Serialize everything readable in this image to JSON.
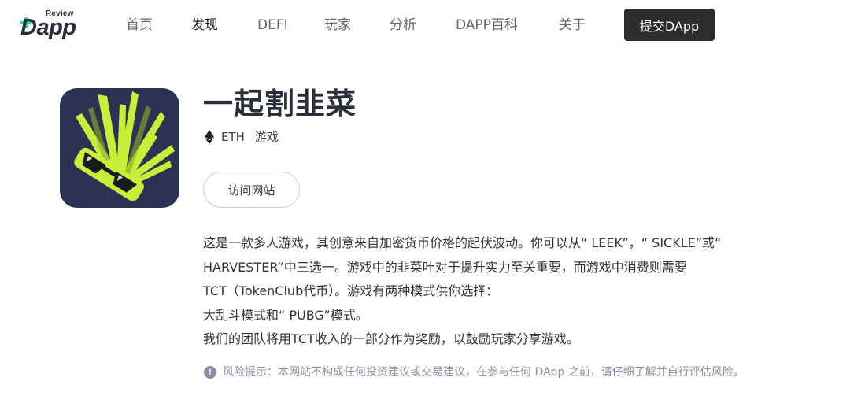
{
  "header": {
    "logo": {
      "top": "Review",
      "word": "Dapp"
    },
    "nav": [
      {
        "label": "首页",
        "active": false
      },
      {
        "label": "发现",
        "active": true
      },
      {
        "label": "DEFI",
        "active": false
      },
      {
        "label": "玩家",
        "active": false
      },
      {
        "label": "分析",
        "active": false
      },
      {
        "label": "DAPP百科",
        "active": false
      },
      {
        "label": "关于",
        "active": false
      }
    ],
    "submit_label": "提交DApp"
  },
  "app": {
    "title": "一起割韭菜",
    "chain": "ETH",
    "category": "游戏",
    "icon": "leek-with-sunglasses-icon",
    "visit_label": "访问网站"
  },
  "description": [
    "这是一款多人游戏，其创意来自加密货币价格的起伏波动。你可以从“ LEEK”，“ SICKLE”或“",
    "HARVESTER”中三选一。游戏中的韭菜叶对于提升实力至关重要，而游戏中消费则需要",
    "TCT（TokenClub代币）。游戏有两种模式供你选择：",
    "大乱斗模式和“ PUBG”模式。",
    "我们的团队将用TCT收入的一部分作为奖励，以鼓励玩家分享游戏。"
  ],
  "risk_notice": {
    "icon": "exclamation-circle-icon",
    "text": "风险提示：本网站不构成任何投资建议或交易建议，在参与任何 DApp 之前，请仔细了解并自行评估风险。"
  },
  "colors": {
    "icon_bg": "#2c3253",
    "leaf": "#c8ee3a",
    "accent": "#2dd4a0",
    "submit_bg": "#2d2d2d"
  }
}
